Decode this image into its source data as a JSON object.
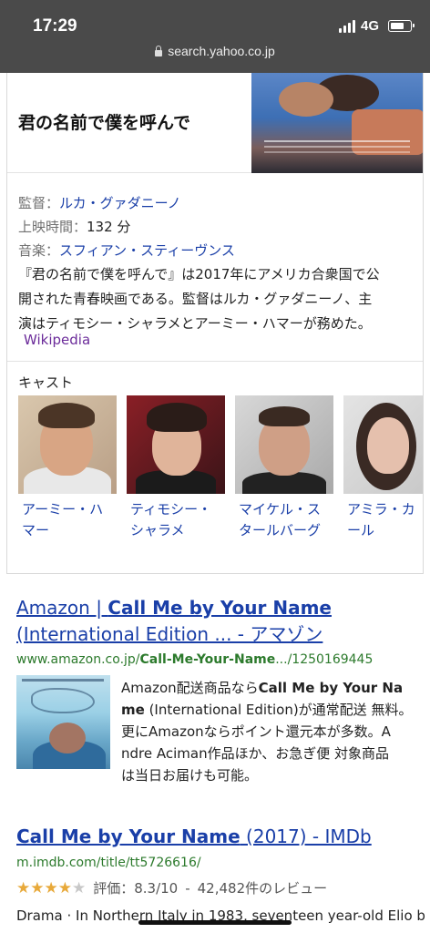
{
  "status_bar": {
    "time": "17:29",
    "network": "4G"
  },
  "url_bar": {
    "domain": "search.yahoo.co.jp"
  },
  "knowledge_panel": {
    "title": "君の名前で僕を呼んで",
    "director_label": "監督：",
    "director": "ルカ・グァダニーノ",
    "runtime_label": "上映時間：",
    "runtime": "132 分",
    "music_label": "音楽：",
    "music": "スフィアン・スティーヴンス",
    "description_lines": [
      "『君の名前で僕を呼んで』は2017年にアメリカ合衆国で公",
      "開された青春映画である。監督はルカ・グァダニーノ、主",
      "演はティモシー・シャラメとアーミー・ハマーが務めた。"
    ],
    "source": "Wikipedia",
    "cast_heading": "キャスト",
    "cast": [
      {
        "name_line1": "アーミー・ハ",
        "name_line2": "マー"
      },
      {
        "name_line1": "ティモシー・",
        "name_line2": "シャラメ"
      },
      {
        "name_line1": "マイケル・ス",
        "name_line2": "タールバーグ"
      },
      {
        "name_line1": "アミラ・カ",
        "name_line2": "ール"
      }
    ]
  },
  "results": [
    {
      "title_part1": "Amazon | ",
      "title_bold": "Call Me by Your Name",
      "title_part2": " (International Edition ... - アマゾン",
      "url_part1": "www.amazon.co.jp/",
      "url_bold": "Call-Me-Your-Name",
      "url_part2": ".../1250169445",
      "snippet_lines": [
        {
          "pre": "Amazon配送商品なら",
          "bold": "Call Me by Your Na",
          "post": ""
        },
        {
          "pre": "",
          "bold": "me",
          "post": " (International Edition)が通常配送 無料。"
        },
        {
          "pre": "更にAmazonならポイント還元本が多数。A",
          "bold": "",
          "post": ""
        },
        {
          "pre": "ndre Aciman作品ほか、お急ぎ便 対象商品",
          "bold": "",
          "post": ""
        },
        {
          "pre": "は当日お届けも可能。",
          "bold": "",
          "post": ""
        }
      ]
    },
    {
      "title_bold": "Call Me by Your Name",
      "title_part2": " (2017) - IMDb",
      "url": "m.imdb.com/title/tt5726616/",
      "rating_text": "評価：8.3/10",
      "rating_value": 4,
      "rating_max": 5,
      "reviews": "42,482件のレビュー",
      "snippet": "Drama · In Northern Italy in 1983, seventeen year-old Elio b"
    }
  ]
}
